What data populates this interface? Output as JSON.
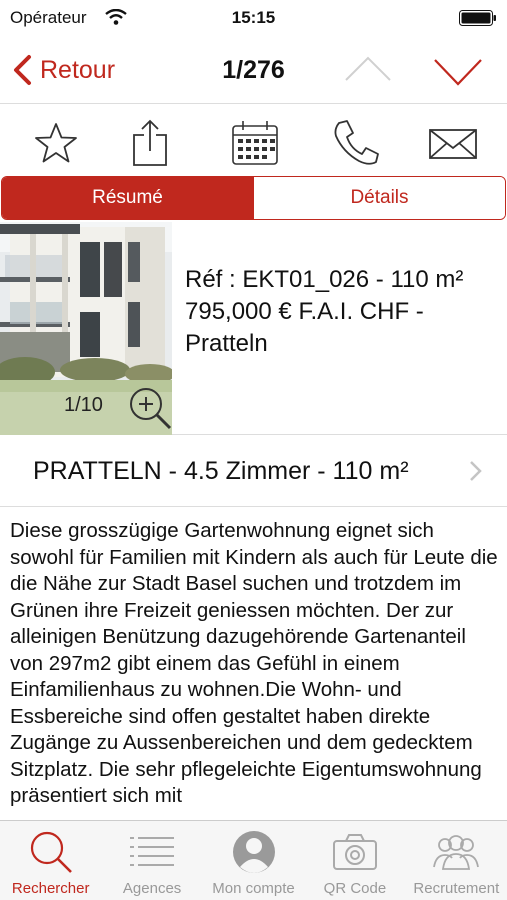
{
  "status_bar": {
    "carrier": "Opérateur",
    "time": "15:15"
  },
  "nav": {
    "back_label": "Retour",
    "title": "1/276"
  },
  "actions": [
    {
      "icon": "star-icon",
      "name": "favorite-button"
    },
    {
      "icon": "share-icon",
      "name": "share-button"
    },
    {
      "icon": "calendar-icon",
      "name": "calendar-button"
    },
    {
      "icon": "phone-icon",
      "name": "call-button"
    },
    {
      "icon": "mail-icon",
      "name": "mail-button"
    }
  ],
  "segments": {
    "summary": "Résumé",
    "details": "Détails",
    "active": "summary"
  },
  "listing": {
    "photo_counter": "1/10",
    "reference_line": "Réf : EKT01_026 - 110 m²",
    "price_line": "795,000  € F.A.I. CHF - Pratteln",
    "title": "PRATTELN - 4.5 Zimmer - 110 m²",
    "description": "Diese grosszügige Gartenwohnung eignet sich sowohl für Familien mit Kindern als auch für Leute die die Nähe zur Stadt Basel suchen und trotzdem im Grünen ihre Freizeit geniessen möchten. Der zur alleinigen Benützung dazugehörende Gartenanteil von 297m2 gibt einem das Gefühl in einem Einfamilienhaus zu wohnen.Die Wohn- und Essbereiche sind offen gestaltet haben direkte Zugänge zu Aussenbereichen und dem gedecktem Sitzplatz. Die sehr pflegeleichte Eigentumswohnung präsentiert sich mit"
  },
  "tabs": {
    "search": "Rechercher",
    "agencies": "Agences",
    "account": "Mon compte",
    "qr": "QR Code",
    "recruitment": "Recrutement",
    "active": "search"
  },
  "colors": {
    "accent": "#c0281e",
    "tab_inactive": "#999999"
  }
}
